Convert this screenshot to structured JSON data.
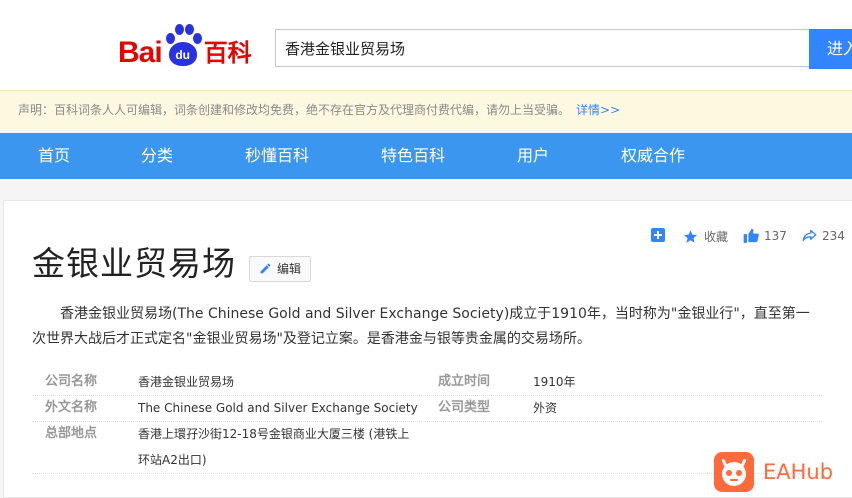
{
  "logo": {
    "bai": "Bai",
    "du": "du",
    "baike": "百科"
  },
  "search": {
    "query": "香港金银业贸易场",
    "button_label": "进入词条"
  },
  "notice": {
    "text": "声明：百科词条人人可编辑，词条创建和修改均免费，绝不存在官方及代理商付费代编，请勿上当受骗。",
    "link": "详情>>"
  },
  "nav": {
    "items": [
      "首页",
      "分类",
      "秒懂百科",
      "特色百科",
      "用户",
      "权威合作"
    ]
  },
  "actions": {
    "favorite_label": "收藏",
    "like_count": "137",
    "share_count": "234"
  },
  "entry": {
    "title": "金银业贸易场",
    "edit_label": "编辑",
    "summary": "香港金银业贸易场(The Chinese Gold and Silver Exchange Society)成立于1910年，当时称为\"金银业行\"，直至第一次世界大战后才正式定名\"金银业贸易场\"及登记立案。是香港金与银等贵金属的交易场所。"
  },
  "basic_info": [
    {
      "label": "公司名称",
      "value": "香港金银业贸易场"
    },
    {
      "label": "外文名称",
      "value": "The Chinese Gold and Silver Exchange Society"
    },
    {
      "label": "总部地点",
      "value": "香港上環孖沙街12-18号金银商业大厦三楼 (港铁上环站A2出口)"
    },
    {
      "label": "成立时间",
      "value": "1910年"
    },
    {
      "label": "公司类型",
      "value": "外资"
    }
  ],
  "watermark": {
    "text": "EAHub"
  },
  "colors": {
    "nav_blue": "#3b96ef",
    "search_blue": "#3385ff",
    "logo_red": "#e10601",
    "logo_blue": "#2932e1",
    "notice_bg": "#fdf9e1"
  }
}
